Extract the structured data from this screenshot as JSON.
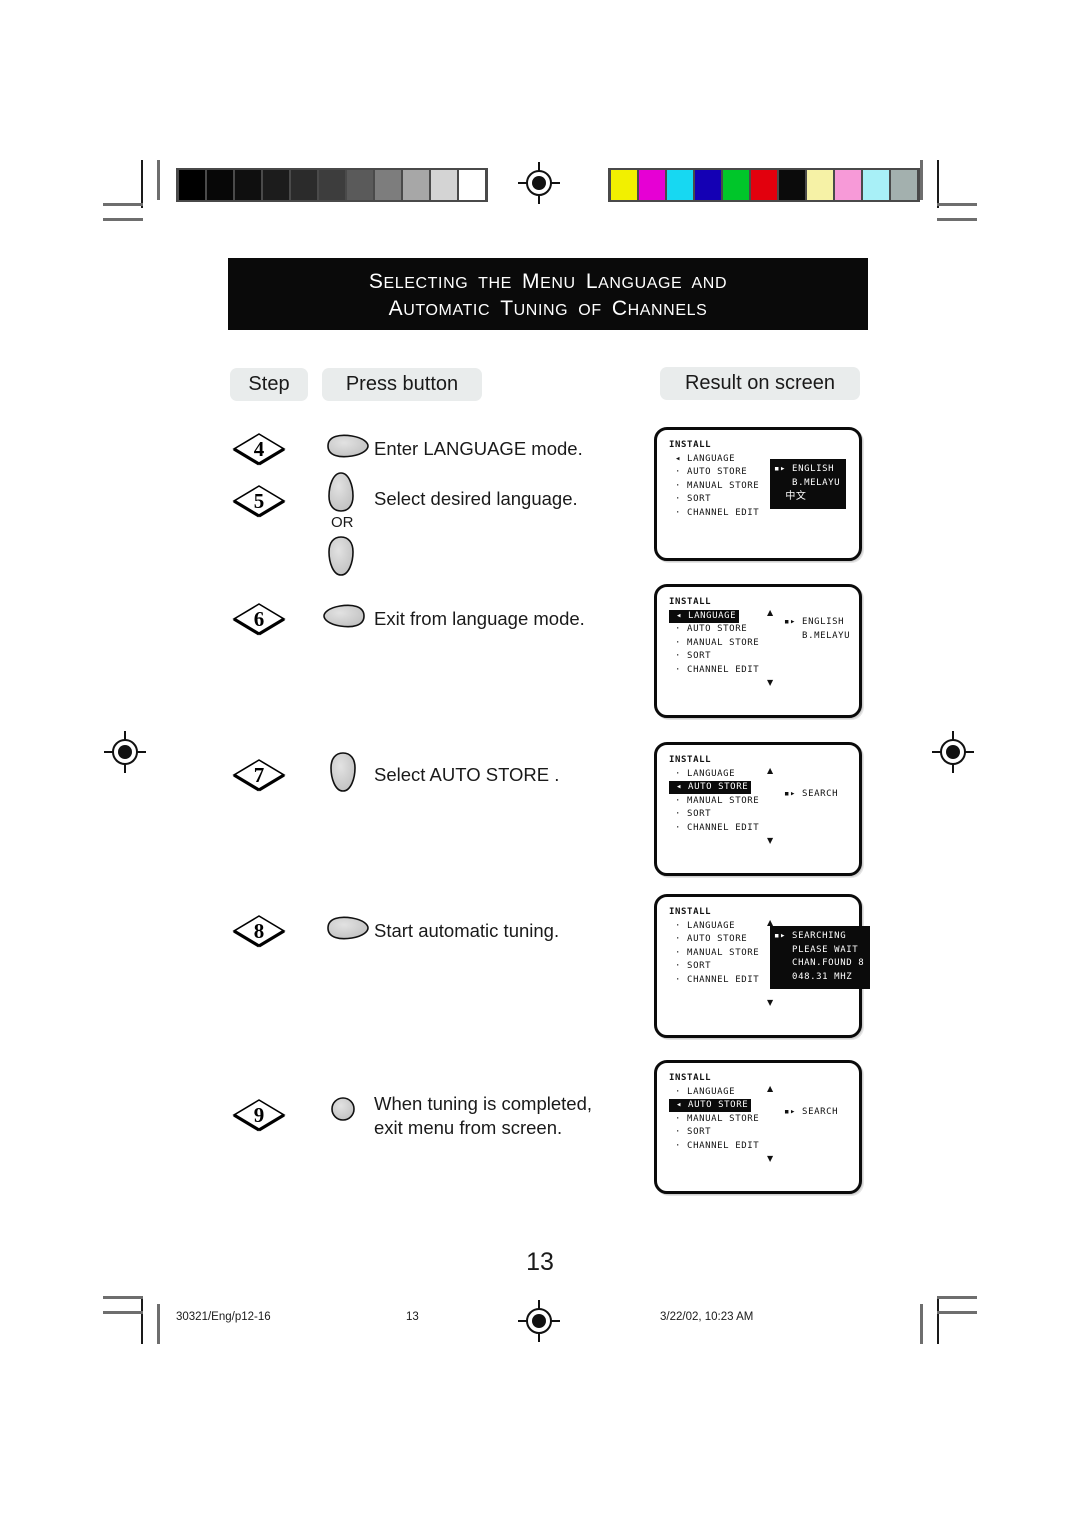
{
  "title": {
    "line1": [
      {
        "big": "S",
        "rest": "ELECTING"
      },
      {
        "big": "",
        "rest": "THE"
      },
      {
        "big": "M",
        "rest": "ENU"
      },
      {
        "big": "L",
        "rest": "ANGUAGE"
      },
      {
        "big": "",
        "rest": "AND"
      }
    ],
    "line2": [
      {
        "big": "A",
        "rest": "UTOMATIC"
      },
      {
        "big": "T",
        "rest": "UNING"
      },
      {
        "big": "",
        "rest": "OF"
      },
      {
        "big": "C",
        "rest": "HANNELS"
      }
    ]
  },
  "columns": {
    "step": "Step",
    "press_button": "Press button",
    "result": "Result on screen"
  },
  "steps": [
    {
      "number": "4",
      "text": "Enter LANGUAGE mode.",
      "button": "menu-right-button"
    },
    {
      "number": "5",
      "text": "Select desired language.",
      "button": "up-down-buttons",
      "or_label": "OR"
    },
    {
      "number": "6",
      "text": "Exit from language mode.",
      "button": "menu-left-button"
    },
    {
      "number": "7",
      "text": "Select AUTO STORE .",
      "button": "down-button"
    },
    {
      "number": "8",
      "text": "Start automatic tuning.",
      "button": "menu-right-button"
    },
    {
      "number": "9",
      "text": "When tuning is completed,\nexit menu from screen.",
      "button": "round-button"
    }
  ],
  "screens": [
    {
      "heading": "INSTALL",
      "items": [
        {
          "label": "LANGUAGE",
          "marker": "left-triangle",
          "highlighted": false
        },
        {
          "label": "AUTO STORE",
          "marker": "bullet",
          "highlighted": false
        },
        {
          "label": "MANUAL STORE",
          "marker": "bullet",
          "highlighted": false
        },
        {
          "label": "SORT",
          "marker": "bullet",
          "highlighted": false
        },
        {
          "label": "CHANNEL EDIT",
          "marker": "bullet",
          "highlighted": false
        }
      ],
      "value_box": {
        "lines": [
          "ENGLISH",
          "B.MELAYU",
          "中文"
        ],
        "selected_index": 0
      },
      "scroll_up": false,
      "scroll_down": false
    },
    {
      "heading": "INSTALL",
      "items": [
        {
          "label": "LANGUAGE",
          "marker": "left-triangle",
          "highlighted": true
        },
        {
          "label": "AUTO STORE",
          "marker": "bullet",
          "highlighted": false
        },
        {
          "label": "MANUAL STORE",
          "marker": "bullet",
          "highlighted": false
        },
        {
          "label": "SORT",
          "marker": "bullet",
          "highlighted": false
        },
        {
          "label": "CHANNEL EDIT",
          "marker": "bullet",
          "highlighted": false
        }
      ],
      "value_plain": {
        "lines": [
          "ENGLISH",
          "B.MELAYU"
        ],
        "selected_index": 0
      },
      "scroll_up": true,
      "scroll_down": true
    },
    {
      "heading": "INSTALL",
      "items": [
        {
          "label": "LANGUAGE",
          "marker": "bullet",
          "highlighted": false
        },
        {
          "label": "AUTO STORE",
          "marker": "left-triangle",
          "highlighted": true
        },
        {
          "label": "MANUAL STORE",
          "marker": "bullet",
          "highlighted": false
        },
        {
          "label": "SORT",
          "marker": "bullet",
          "highlighted": false
        },
        {
          "label": "CHANNEL EDIT",
          "marker": "bullet",
          "highlighted": false
        }
      ],
      "value_plain": {
        "lines": [
          "SEARCH"
        ],
        "selected_index": 0
      },
      "scroll_up": true,
      "scroll_down": true
    },
    {
      "heading": "INSTALL",
      "items": [
        {
          "label": "LANGUAGE",
          "marker": "bullet",
          "highlighted": false
        },
        {
          "label": "AUTO STORE",
          "marker": "bullet",
          "highlighted": false
        },
        {
          "label": "MANUAL STORE",
          "marker": "bullet",
          "highlighted": false
        },
        {
          "label": "SORT",
          "marker": "bullet",
          "highlighted": false
        },
        {
          "label": "CHANNEL EDIT",
          "marker": "bullet",
          "highlighted": false
        }
      ],
      "value_box": {
        "lines": [
          "SEARCHING",
          "PLEASE WAIT",
          "CHAN.FOUND 8",
          "048.31 MHZ"
        ],
        "selected_index": 0
      },
      "scroll_up": true,
      "scroll_down": true
    },
    {
      "heading": "INSTALL",
      "items": [
        {
          "label": "LANGUAGE",
          "marker": "bullet",
          "highlighted": false
        },
        {
          "label": "AUTO STORE",
          "marker": "left-triangle",
          "highlighted": true
        },
        {
          "label": "MANUAL STORE",
          "marker": "bullet",
          "highlighted": false
        },
        {
          "label": "SORT",
          "marker": "bullet",
          "highlighted": false
        },
        {
          "label": "CHANNEL EDIT",
          "marker": "bullet",
          "highlighted": false
        }
      ],
      "value_plain": {
        "lines": [
          "SEARCH"
        ],
        "selected_index": 0
      },
      "scroll_up": true,
      "scroll_down": true
    }
  ],
  "page_number": "13",
  "footer": {
    "file_ref": "30321/Eng/p12-16",
    "page": "13",
    "timestamp": "3/22/02, 10:23 AM"
  },
  "calibration": {
    "grayscale_patches": [
      "#000000",
      "#070707",
      "#0f0f0f",
      "#1c1c1c",
      "#2b2b2b",
      "#3d3d3d",
      "#5a5a5a",
      "#7d7d7d",
      "#a7a7a7",
      "#d4d4d4",
      "#ffffff"
    ],
    "color_patches": [
      "#f2f000",
      "#e600d4",
      "#17d8f2",
      "#1400b4",
      "#00c62a",
      "#e2000d",
      "#0b0b0b",
      "#f6f2a6",
      "#f79ad8",
      "#a8f0f7",
      "#a3b0ae"
    ]
  }
}
